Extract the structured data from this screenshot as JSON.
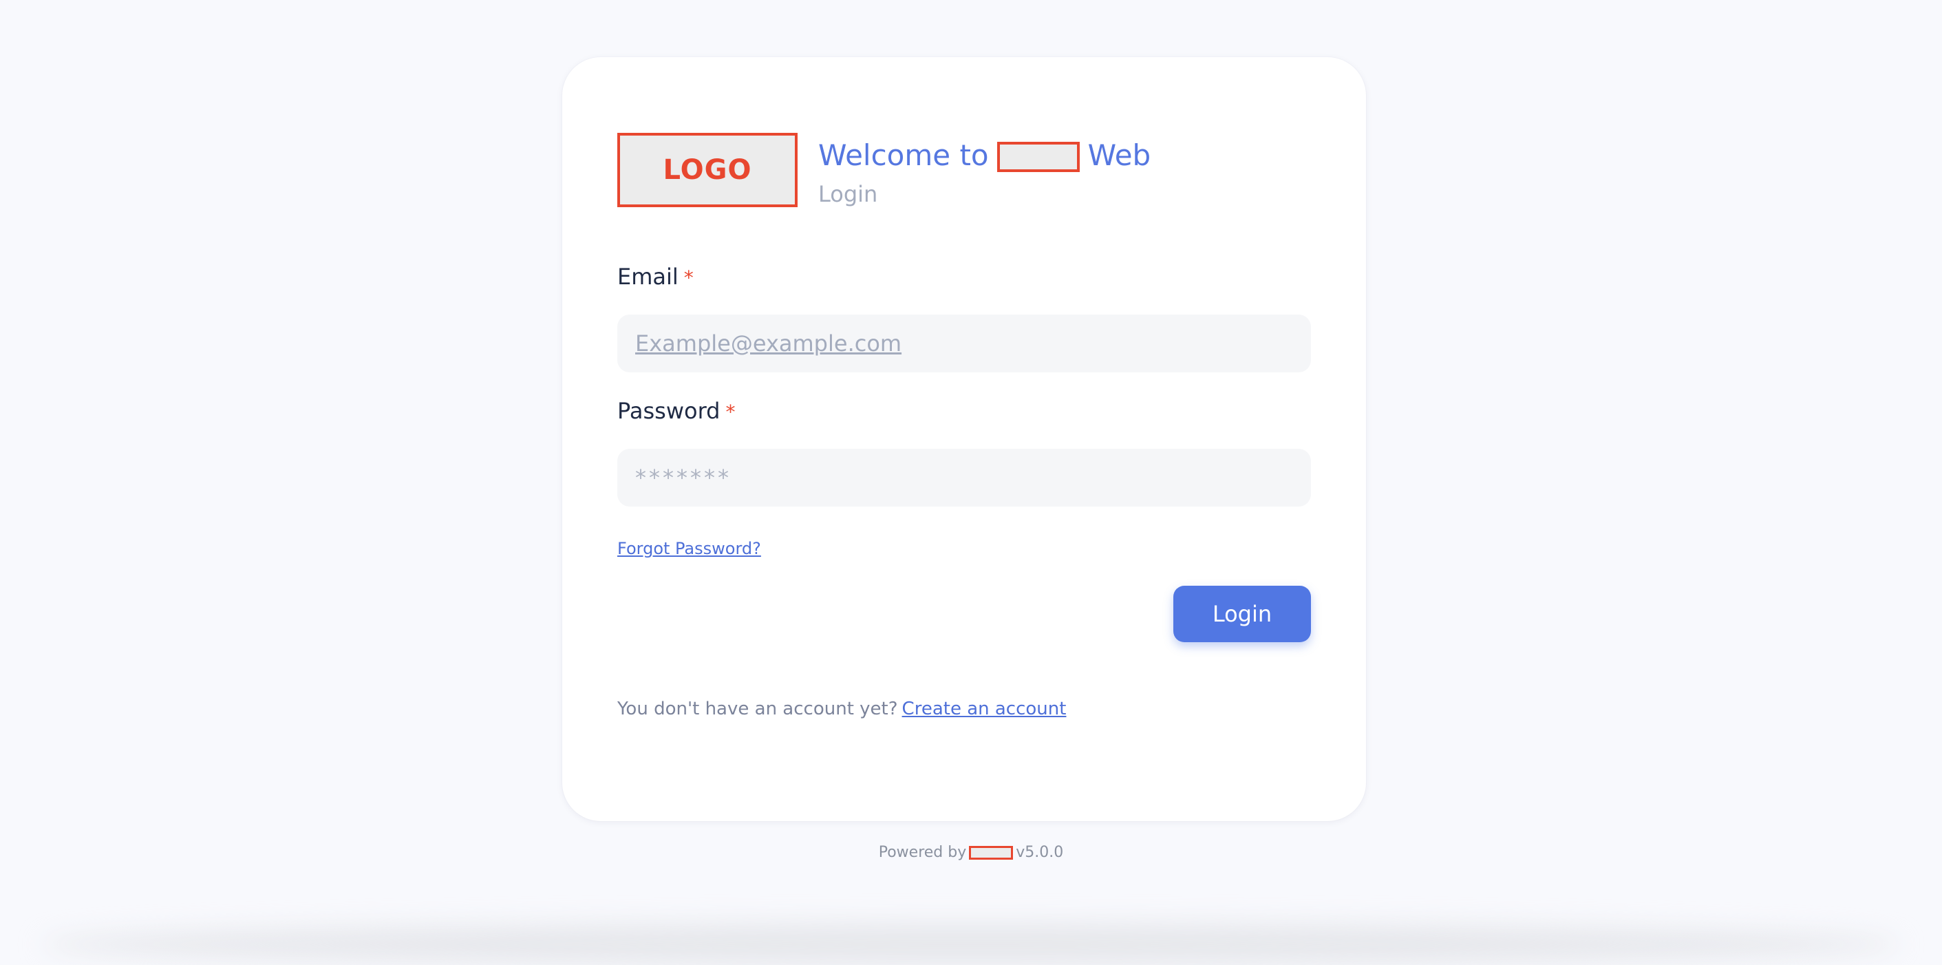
{
  "brand": {
    "logo_text": "LOGO",
    "welcome_prefix": "Welcome to",
    "welcome_suffix": "Web",
    "subtitle": "Login"
  },
  "form": {
    "email": {
      "label": "Email",
      "required_mark": "*",
      "placeholder": "Example@example.com",
      "value": ""
    },
    "password": {
      "label": "Password",
      "required_mark": "*",
      "placeholder": "*******",
      "value": ""
    },
    "forgot_password_link": "Forgot Password?",
    "submit_label": "Login"
  },
  "signup": {
    "prompt": "You don't have an account yet?",
    "link_label": "Create an account"
  },
  "footer": {
    "powered_by": "Powered by",
    "version": "v5.0.0"
  },
  "colors": {
    "accent": "#5177e3",
    "required": "#e8472f",
    "page_bg": "#f8f9fd"
  }
}
